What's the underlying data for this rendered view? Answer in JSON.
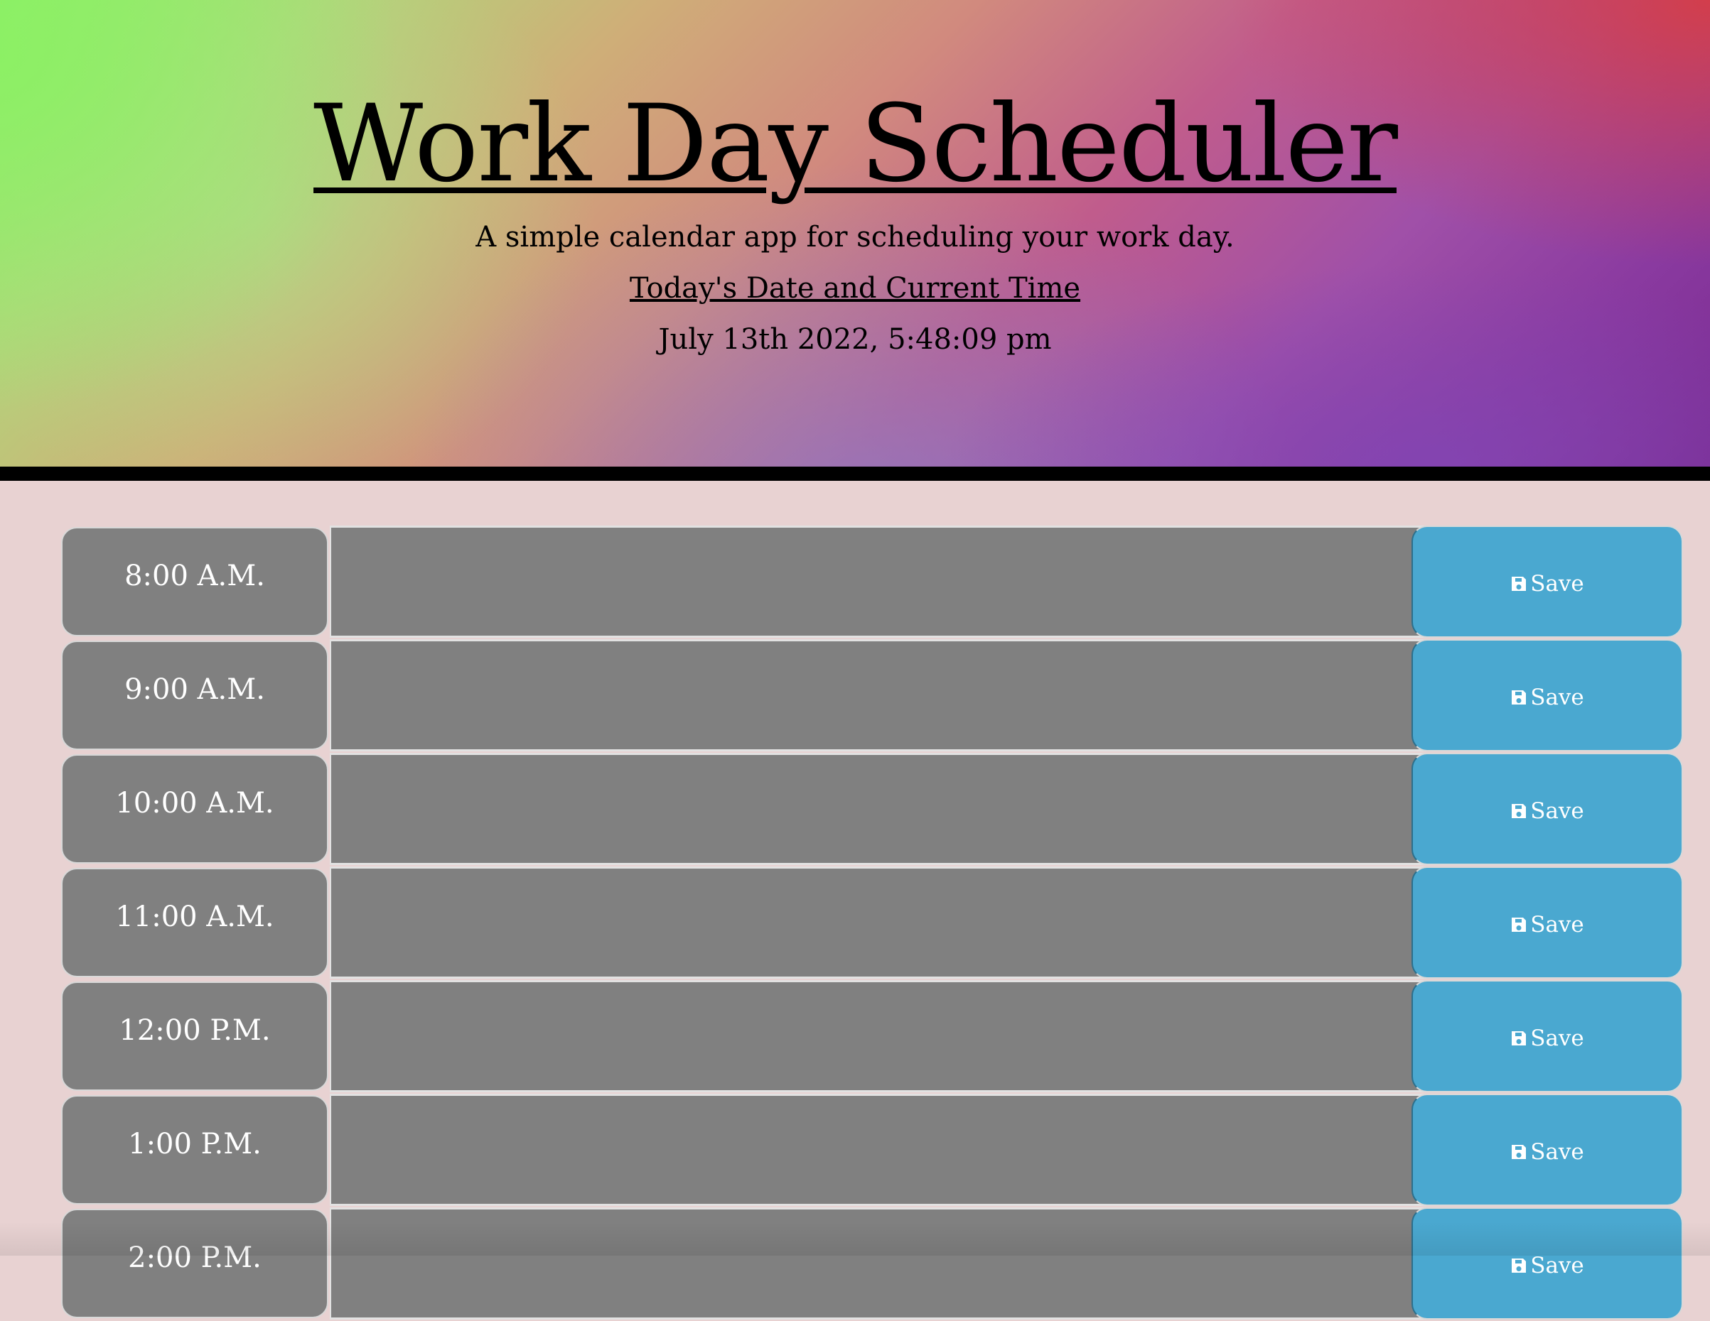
{
  "header": {
    "title": "Work Day Scheduler",
    "subtitle": "A simple calendar app for scheduling your work day.",
    "date_heading": "Today's Date and Current Time",
    "current_datetime": "July 13th 2022, 5:48:09 pm"
  },
  "colors": {
    "hour_block": "#808080",
    "save_button": "#4aa8d0",
    "page_background": "#e8d2d2",
    "header_border": "#000000"
  },
  "schedule": {
    "rows": [
      {
        "hour": "8:00 A.M.",
        "entry": "",
        "save_label": "Save",
        "icon": "save-icon"
      },
      {
        "hour": "9:00 A.M.",
        "entry": "",
        "save_label": "Save",
        "icon": "save-icon"
      },
      {
        "hour": "10:00 A.M.",
        "entry": "",
        "save_label": "Save",
        "icon": "save-icon"
      },
      {
        "hour": "11:00 A.M.",
        "entry": "",
        "save_label": "Save",
        "icon": "save-icon"
      },
      {
        "hour": "12:00 P.M.",
        "entry": "",
        "save_label": "Save",
        "icon": "save-icon"
      },
      {
        "hour": "1:00 P.M.",
        "entry": "",
        "save_label": "Save",
        "icon": "save-icon"
      },
      {
        "hour": "2:00 P.M.",
        "entry": "",
        "save_label": "Save",
        "icon": "save-icon"
      }
    ]
  }
}
